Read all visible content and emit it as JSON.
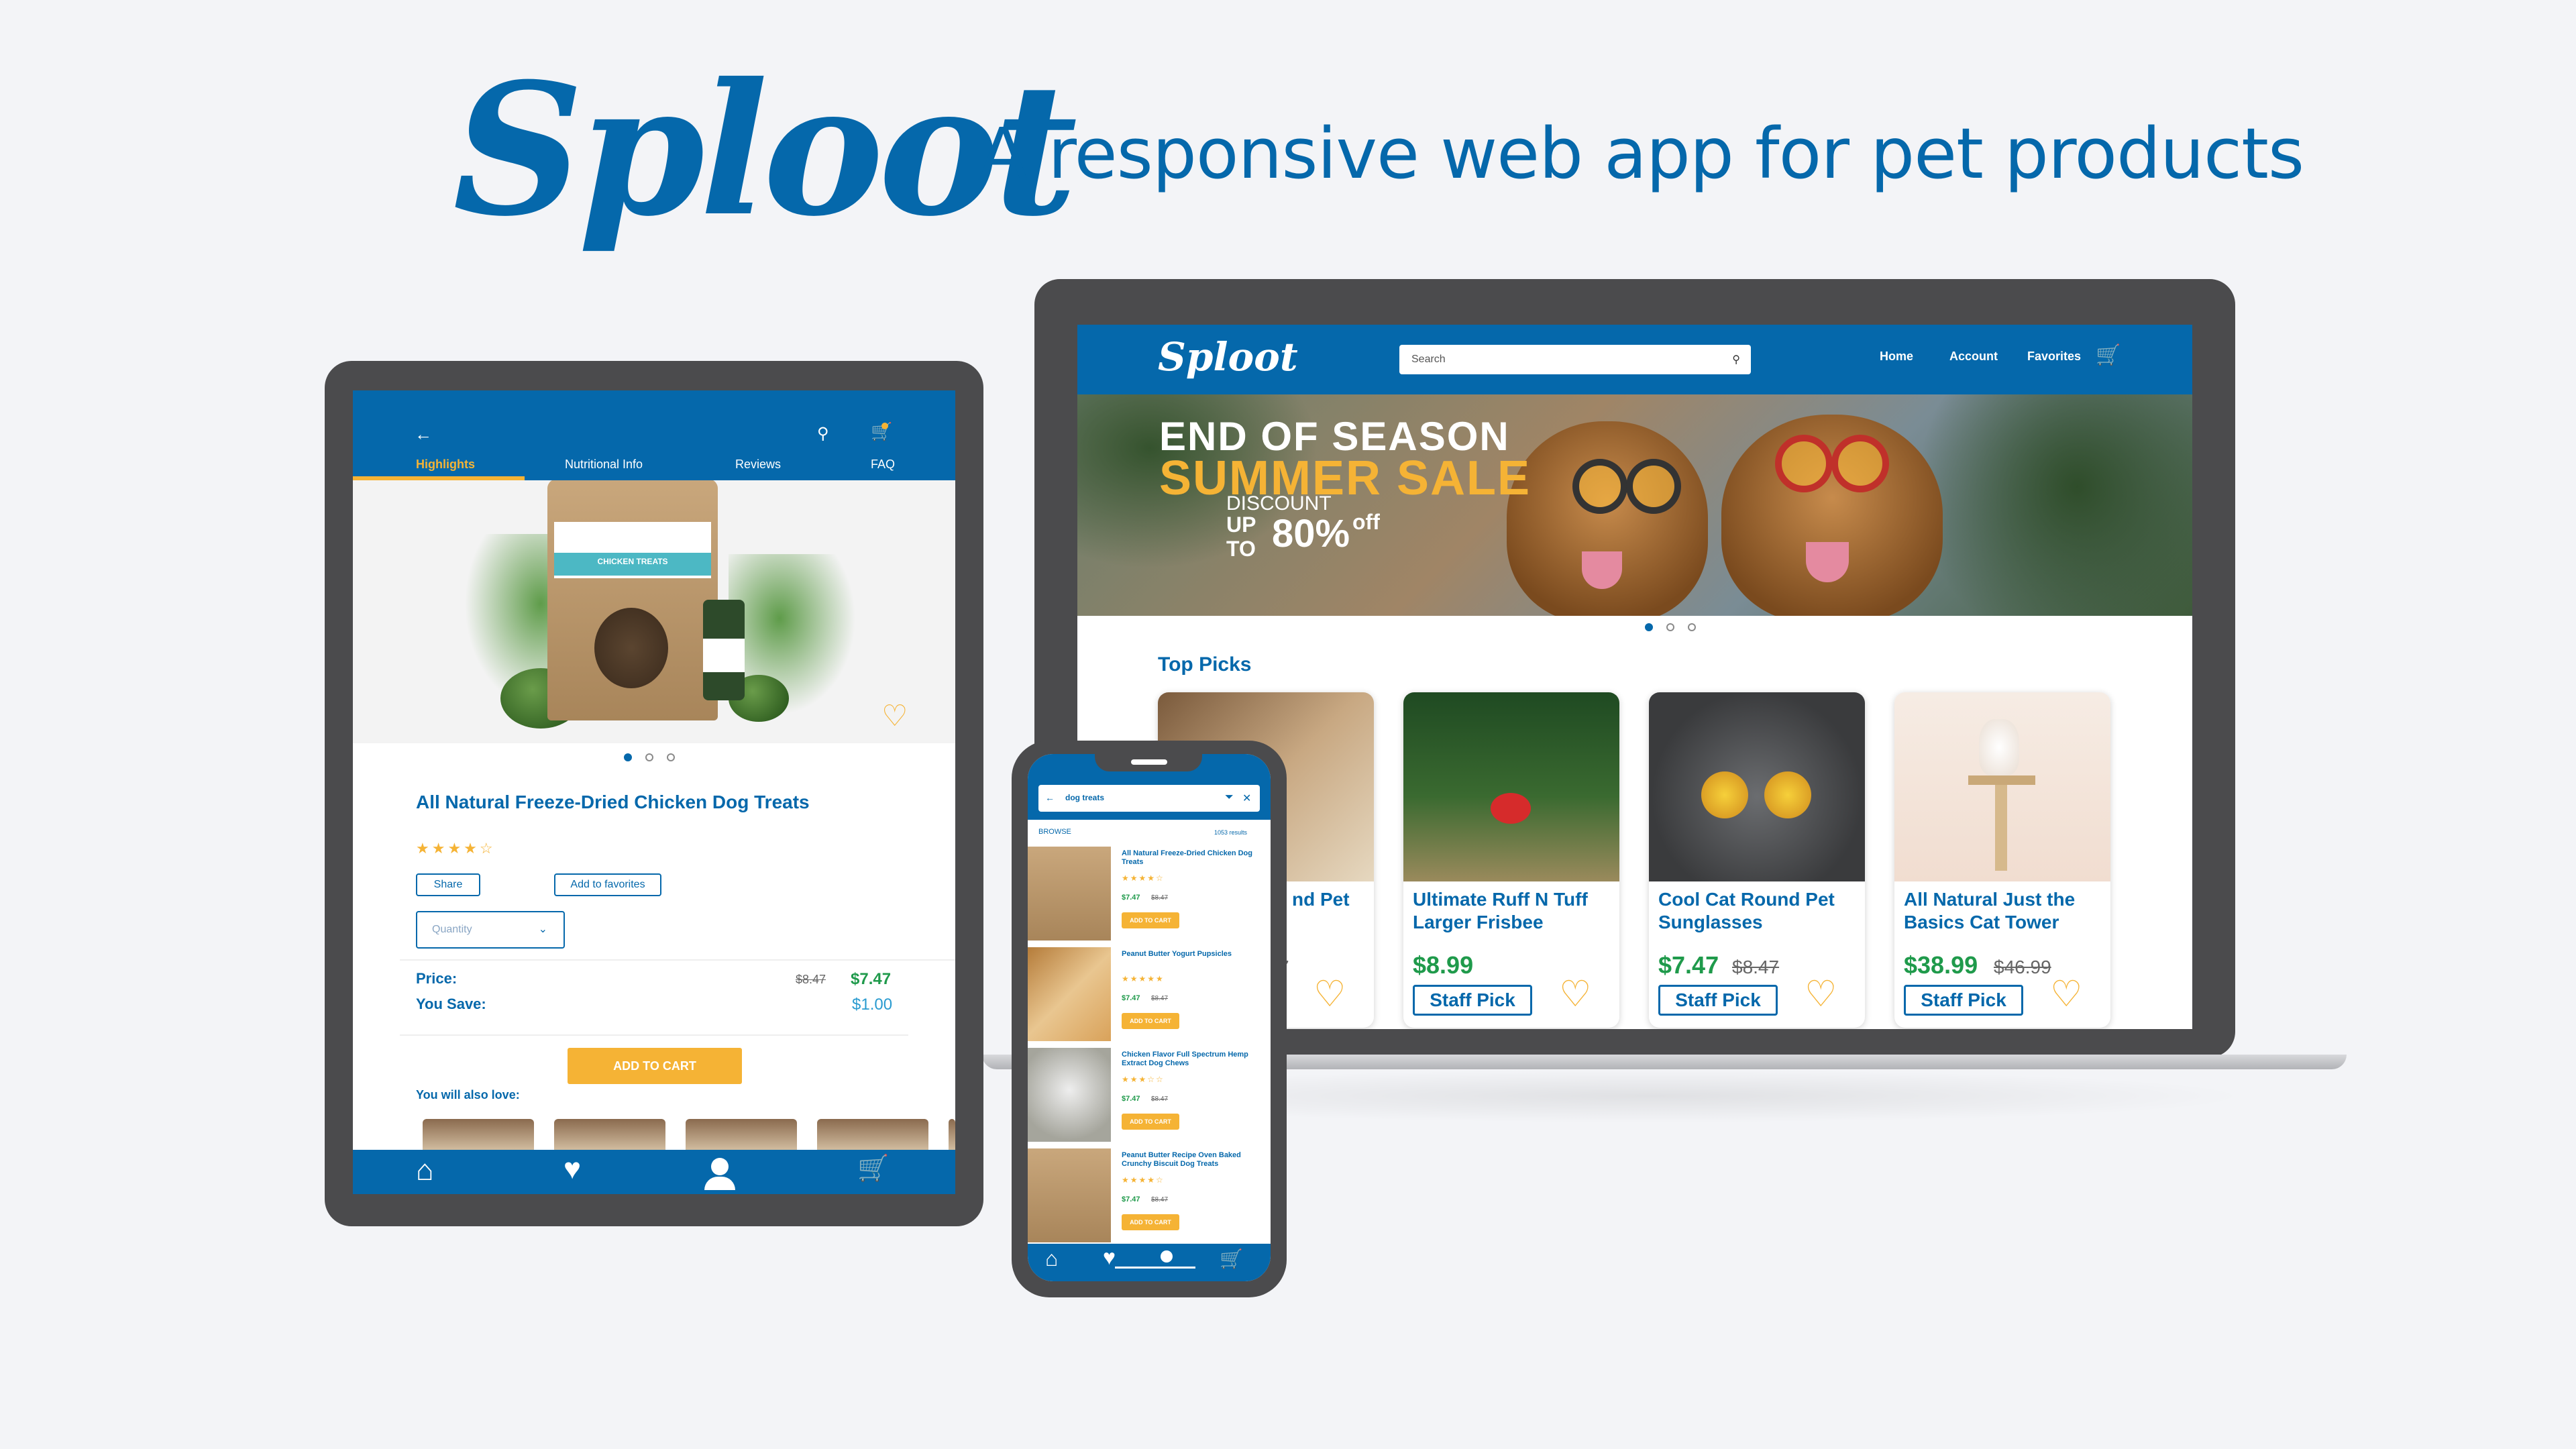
{
  "header": {
    "logo": "Sploot",
    "tagline": "A responsive web app for pet products"
  },
  "laptop": {
    "logo": "Sploot",
    "search_placeholder": "Search",
    "nav": [
      "Home",
      "Account",
      "Favorites"
    ],
    "hero": {
      "line1": "END OF SEASON",
      "line2": "SUMMER SALE",
      "discount": "DISCOUNT",
      "up": "UP",
      "to": "TO",
      "pct": "80%",
      "off": "off"
    },
    "section_title": "Top Picks",
    "products": [
      {
        "name": "nd Pet",
        "price": "",
        "old": "7",
        "pick": ""
      },
      {
        "name": "Ultimate Ruff N Tuff Larger Frisbee",
        "price": "$8.99",
        "old": "",
        "pick": "Staff Pick"
      },
      {
        "name": "Cool Cat Round Pet Sunglasses",
        "price": "$7.47",
        "old": "$8.47",
        "pick": "Staff Pick"
      },
      {
        "name": "All Natural Just the Basics Cat Tower",
        "price": "$38.99",
        "old": "$46.99",
        "pick": "Staff Pick"
      }
    ]
  },
  "tablet": {
    "tabs": [
      "Highlights",
      "Nutritional Info",
      "Reviews",
      "FAQ"
    ],
    "product_title": "All Natural Freeze-Dried Chicken Dog Treats",
    "stars": "★★★★☆",
    "share": "Share",
    "add_fav": "Add to favorites",
    "quantity": "Quantity",
    "price_label": "Price:",
    "price_old": "$8.47",
    "price": "$7.47",
    "save_label": "You Save:",
    "save": "$1.00",
    "add_to_cart": "ADD TO CART",
    "also_love": "You will also love:",
    "bag_text": "CHICKEN TREATS"
  },
  "phone": {
    "search_value": "dog treats",
    "browse": "BROWSE",
    "results": "1053 results",
    "items": [
      {
        "name": "All Natural Freeze-Dried Chicken Dog Treats",
        "stars": "★★★★☆",
        "price": "$7.47",
        "old": "$8.47",
        "add": "ADD TO CART"
      },
      {
        "name": "Peanut Butter Yogurt Pupsicles",
        "stars": "★★★★★",
        "price": "$7.47",
        "old": "$8.47",
        "add": "ADD TO CART"
      },
      {
        "name": "Chicken Flavor Full Spectrum Hemp Extract Dog Chews",
        "stars": "★★★☆☆",
        "price": "$7.47",
        "old": "$8.47",
        "add": "ADD TO CART"
      },
      {
        "name": "Peanut Butter Recipe Oven Baked Crunchy Biscuit Dog Treats",
        "stars": "★★★★☆",
        "price": "$7.47",
        "old": "$8.47",
        "add": "ADD TO CART"
      }
    ]
  },
  "colors": {
    "brand": "#0568ab",
    "accent": "#f5b335",
    "price": "#1f9a4b"
  }
}
